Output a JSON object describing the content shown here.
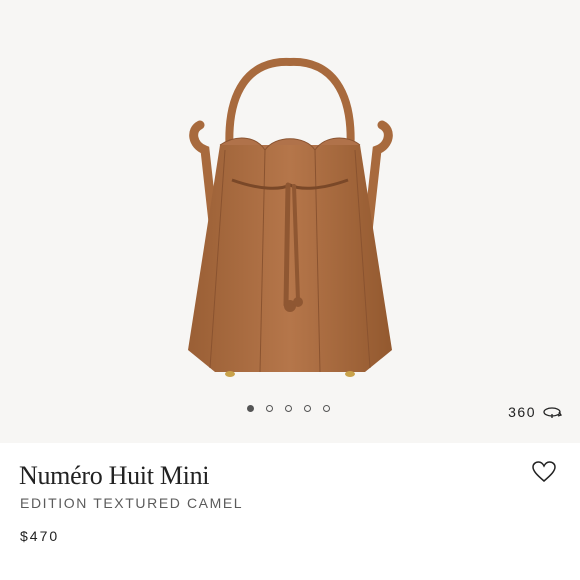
{
  "product": {
    "title": "Numéro Huit Mini",
    "edition": "EDITION TEXTURED CAMEL",
    "price": "$470"
  },
  "gallery": {
    "image_count": 5,
    "active_index": 0,
    "view_360_label": "360",
    "view_360_icon": "rotate-360-icon"
  },
  "actions": {
    "wishlist_icon": "heart-outline-icon"
  },
  "colors": {
    "leather": "#a86a3d",
    "background": "#f7f6f4",
    "text": "#222222"
  }
}
